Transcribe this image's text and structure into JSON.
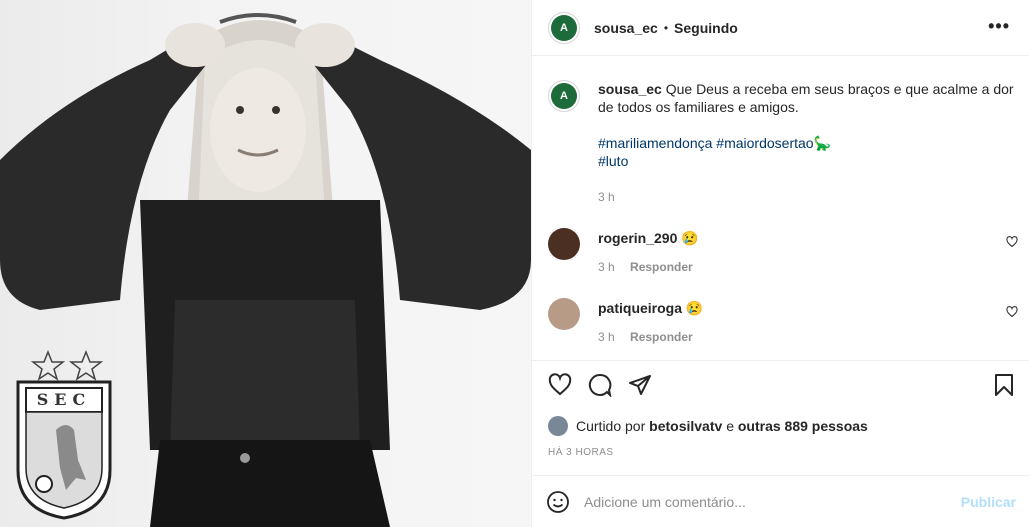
{
  "post": {
    "username": "sousa_ec",
    "dot": "•",
    "follow_state": "Seguindo",
    "more_label": "•••",
    "logo_text": "A"
  },
  "caption": {
    "username": "sousa_ec",
    "text": "Que Deus a receba em seus braços e que acalme a dor de todos os familiares e amigos.",
    "hashtags_line1": [
      "#mariliamendonça",
      "#maiordosertao"
    ],
    "emoji": "🦕",
    "hashtags_line2": [
      "#luto"
    ],
    "time": "3 h"
  },
  "comments": [
    {
      "username": "rogerin_290",
      "emoji": "😢",
      "time": "3 h",
      "reply_label": "Responder"
    },
    {
      "username": "patiqueiroga",
      "emoji": "😢",
      "time": "3 h",
      "reply_label": "Responder"
    }
  ],
  "likes": {
    "prefix": "Curtido por",
    "user": "betosilvatv",
    "connector": "e",
    "others": "outras 889 pessoas"
  },
  "posted_ago": "HÁ 3 HORAS",
  "comment_box": {
    "placeholder": "Adicione um comentário...",
    "publish_label": "Publicar"
  },
  "photo": {
    "crest_text": "SEC"
  },
  "colors": {
    "hashtag": "#00376b",
    "muted": "#8e8e8e",
    "publish_disabled": "#b2dffc",
    "club_green": "#1d6b3a"
  }
}
